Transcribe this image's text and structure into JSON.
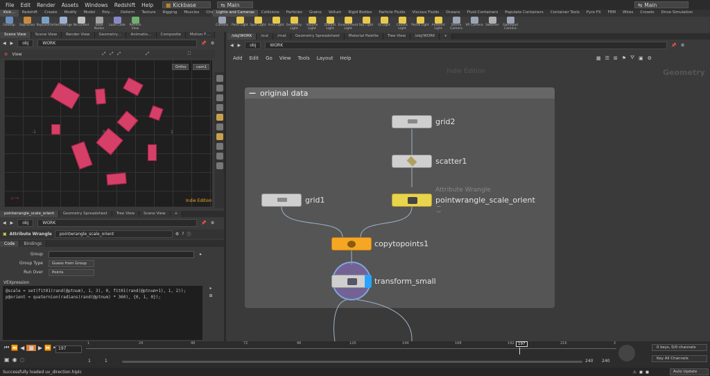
{
  "menubar": {
    "items": [
      "File",
      "Edit",
      "Render",
      "Assets",
      "Windows",
      "Redshift",
      "Help"
    ],
    "desktop": "Kickbase",
    "context": "Main",
    "right_context": "Main"
  },
  "shelf_left": {
    "tabs": [
      "Kick…",
      "Redshift",
      "Create",
      "Modify",
      "Model",
      "Poly…",
      "Deform",
      "Texture",
      "Rigging",
      "Muscles",
      "Char…"
    ],
    "tools": [
      "GeoRop",
      "SopToGeo",
      "RopGeoFile",
      "SetToMerge",
      "No Linked",
      "Save Nodes",
      "Load Code",
      "Refresh View"
    ]
  },
  "shelf_right": {
    "tabs": [
      "Lights and Cameras",
      "Collisions",
      "Particles",
      "Grains",
      "Vellum",
      "Rigid Bodies",
      "Particle Fluids",
      "Viscous Fluids",
      "Oceans",
      "Fluid Containers",
      "Populate Containers",
      "Container Tools",
      "Pyro FX",
      "FEM",
      "Wires",
      "Crowds",
      "Drive Simulation"
    ],
    "tools": [
      "Camera",
      "Point Light",
      "Spot Light",
      "Area Light",
      "Geometry Light",
      "Volume Light",
      "Distant Light",
      "Environment Light",
      "Sky Light",
      "GI Light",
      "Caustic Light",
      "Portal Light",
      "Ambient Light",
      "Stereo Camera",
      "VR Camera",
      "Switcher",
      "Gamepad Camera"
    ]
  },
  "scene_view": {
    "tabs": [
      "Scene View",
      "Scene View",
      "Render View",
      "Geometry…",
      "Animatio…",
      "Composite",
      "Motion F…"
    ],
    "path": [
      "obj",
      "WORK"
    ],
    "title": "View",
    "ortho": "Ortho",
    "camera": "cam1",
    "watermark": "Indie Edition",
    "axis_labels": [
      "-1",
      "0",
      "1"
    ]
  },
  "param_pane": {
    "tabs": [
      "pointwrangle_scale_orient",
      "Geometry Spreadsheet",
      "Tree View",
      "Scene View"
    ],
    "path": [
      "obj",
      "WORK"
    ],
    "node_type": "Attribute Wrangle",
    "node_name": "pointwrangle_scale_orient",
    "subtabs": [
      "Code",
      "Bindings"
    ],
    "group_label": "Group",
    "group_value": "",
    "group_type_label": "Group Type",
    "group_type_value": "Guess from Group",
    "run_over_label": "Run Over",
    "run_over_value": "Points",
    "vex_label": "VEXpression",
    "code": "@scale = set(fit01(rand(@ptnum), 1, 3), 0, fit01(rand(@ptnum+1), 1, 2));\np@orient = quaternion(radians(rand(@ptnum) * 360), {0, 1, 0});"
  },
  "network": {
    "tabs": [
      "/obj/WORK",
      "/out",
      "/mat",
      "Geometry Spreadsheet",
      "Material Palette",
      "Tree View",
      "/obj/WORK"
    ],
    "path": [
      "obj",
      "WORK"
    ],
    "menu": [
      "Add",
      "Edit",
      "Go",
      "View",
      "Tools",
      "Layout",
      "Help"
    ],
    "watermark": "Indie Edition",
    "context_label": "Geometry",
    "box_title": "original data",
    "nodes": {
      "grid2": "grid2",
      "scatter1": "scatter1",
      "wrangle_type": "Attribute Wrangle",
      "wrangle": "pointwrangle_scale_orient",
      "grid1": "grid1",
      "copy": "copytopoints1",
      "transform": "transform_small"
    },
    "colors": {
      "copy_node": "#f5a623",
      "wrangle_node": "#e8d44d",
      "render_flag": "#29a3ff",
      "box_bg": "#555555"
    }
  },
  "timeline": {
    "current_frame": "197",
    "frame_marker": "197",
    "ticks": [
      "1",
      "24",
      "48",
      "72",
      "96",
      "120",
      "144",
      "168",
      "192",
      "216",
      "2"
    ],
    "start": "1",
    "start2": "1",
    "end": "240",
    "end2": "240",
    "keys_info": "0 keys, 0/0 channels",
    "key_all": "Key All Channels",
    "auto_update": "Auto Update"
  },
  "status": {
    "message": "Successfully loaded uv_direction.hiplc"
  }
}
